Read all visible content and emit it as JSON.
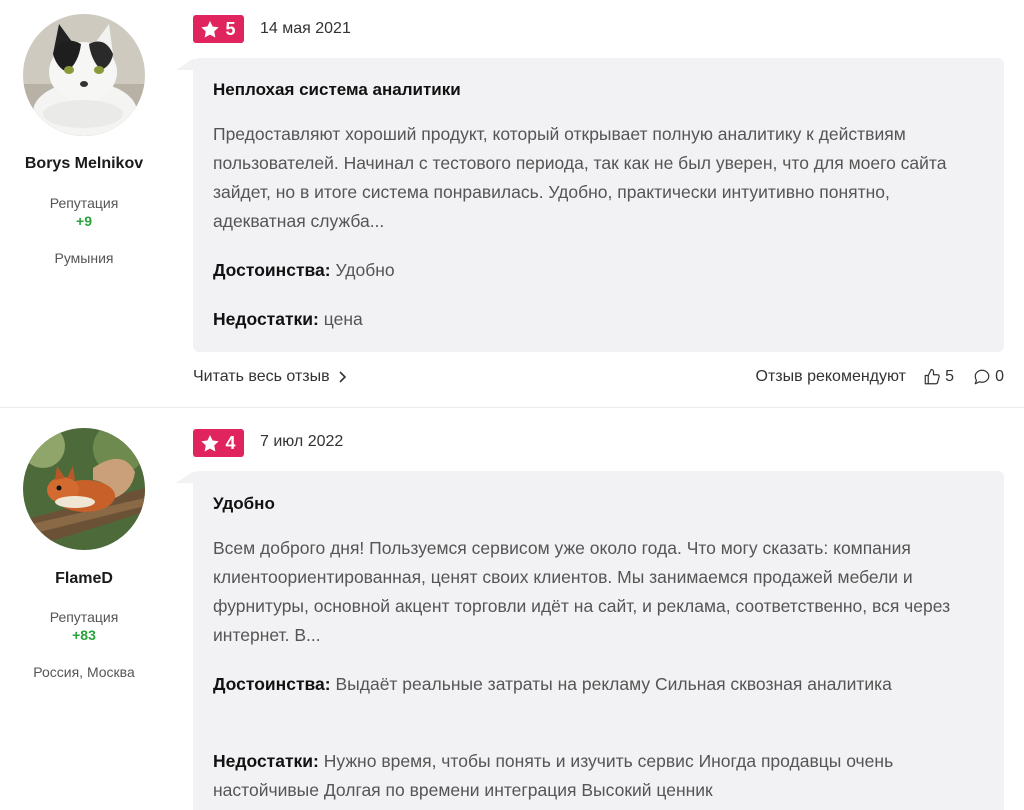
{
  "reviews": [
    {
      "author": {
        "name": "Borys Melnikov",
        "reputation_label": "Репутация",
        "reputation_value": "+9",
        "location": "Румыния",
        "avatar_icon": "cat-avatar"
      },
      "rating": "5",
      "date": "14 мая 2021",
      "title": "Неплохая система аналитики",
      "text": "Предоставляют хороший продукт, который открывает полную аналитику к действиям пользователей. Начинал с тестового периода, так как не был уверен, что для моего сайта зайдет, но в итоге система понравилась. Удобно, практически интуитивно понятно, адекватная служба...",
      "pros_label": "Достоинства:",
      "pros": "Удобно",
      "cons_label": "Недостатки:",
      "cons": "цена",
      "read_more": "Читать весь отзыв",
      "recommend_label": "Отзыв рекомендуют",
      "likes": "5",
      "comments": "0"
    },
    {
      "author": {
        "name": "FlameD",
        "reputation_label": "Репутация",
        "reputation_value": "+83",
        "location": "Россия, Москва",
        "avatar_icon": "squirrel-avatar"
      },
      "rating": "4",
      "date": "7 июл 2022",
      "title": "Удобно",
      "text": "Всем доброго дня! Пользуемся сервисом уже около года. Что могу сказать: компания клиентоориентированная, ценят своих клиентов. Мы занимаемся продажей мебели и фурнитуры, основной акцент торговли идёт на сайт, и реклама, соответственно, вся через интернет. В...",
      "pros_label": "Достоинства:",
      "pros": "Выдаёт реальные затраты на рекламу Сильная сквозная аналитика",
      "cons_label": "Недостатки:",
      "cons": "Нужно время, чтобы понять и изучить сервис Иногда продавцы очень настойчивые Долгая по времени интеграция Высокий ценник"
    }
  ],
  "colors": {
    "badge": "#e0245e",
    "reputation": "#2aa33a",
    "card_bg": "#f2f2f4"
  }
}
